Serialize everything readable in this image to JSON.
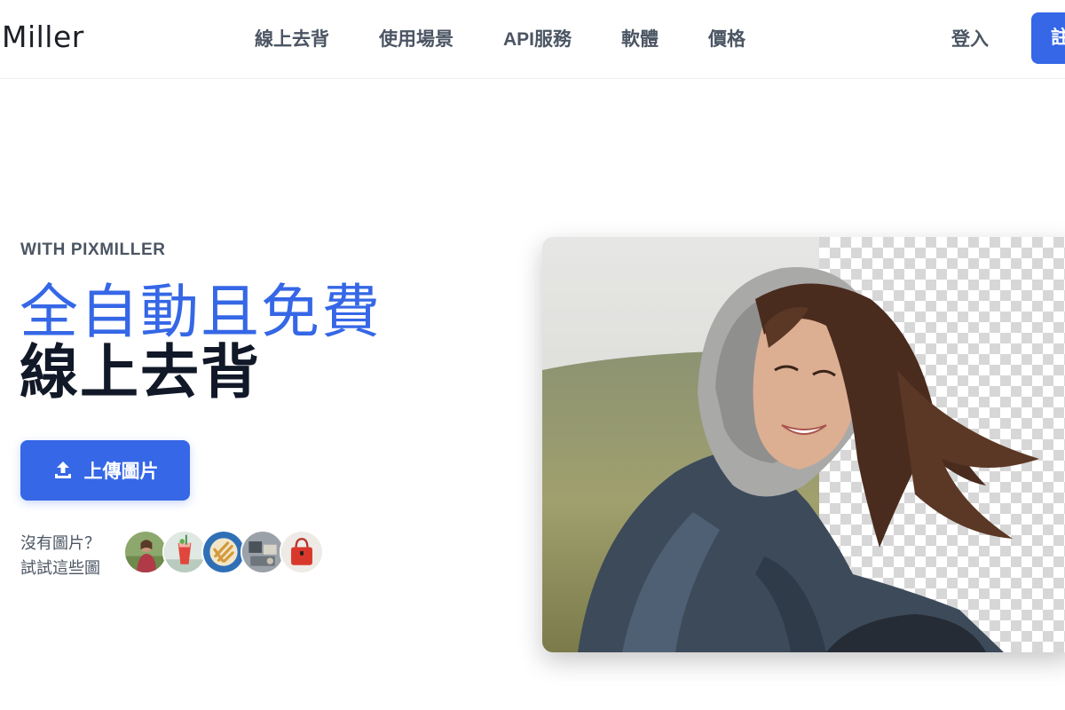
{
  "header": {
    "logo": "Miller",
    "nav": [
      {
        "label": "線上去背"
      },
      {
        "label": "使用場景"
      },
      {
        "label": "API服務"
      },
      {
        "label": "軟體"
      },
      {
        "label": "價格"
      }
    ],
    "login_label": "登入",
    "signup_label": "註"
  },
  "hero": {
    "eyebrow": "WITH PIXMILLER",
    "headline_line1": "全自動且免費",
    "headline_line2": "線上去背",
    "upload_label": "上傳圖片",
    "upload_icon": "upload-icon",
    "try_line1": "沒有圖片？",
    "try_line2": "試試這些圖",
    "samples": [
      {
        "name": "sample-person-icon"
      },
      {
        "name": "sample-drink-icon"
      },
      {
        "name": "sample-food-icon"
      },
      {
        "name": "sample-objects-icon"
      },
      {
        "name": "sample-handbag-icon"
      }
    ],
    "image": "background-removal-demo"
  },
  "colors": {
    "accent": "#3567e6",
    "text_dark": "#111827",
    "text_muted": "#4b5563"
  }
}
